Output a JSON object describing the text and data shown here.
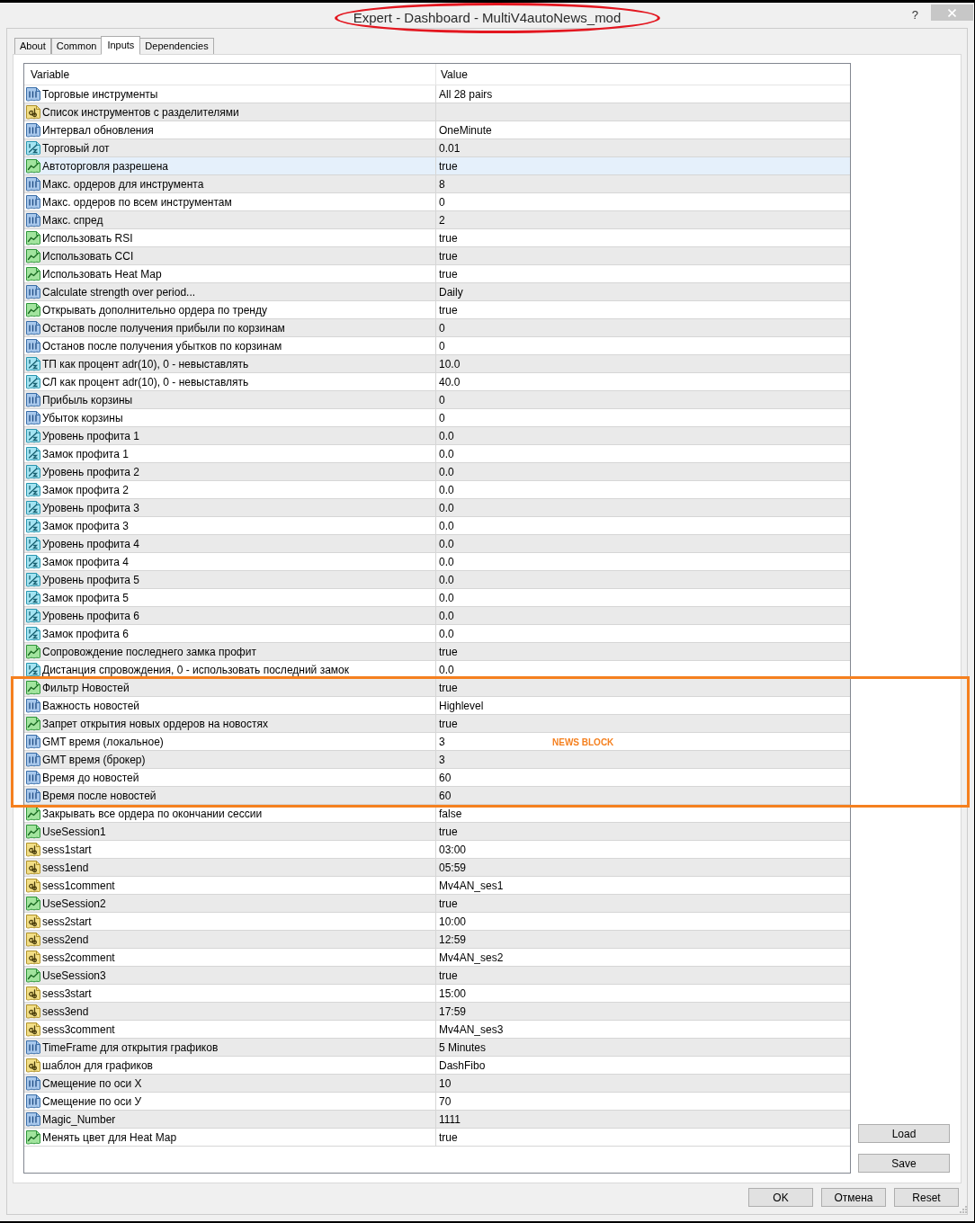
{
  "window": {
    "title": "Expert - Dashboard - MultiV4autoNews_mod",
    "title_circled": true,
    "help": "?"
  },
  "tabs": [
    {
      "label": "About",
      "selected": false
    },
    {
      "label": "Common",
      "selected": false
    },
    {
      "label": "Inputs",
      "selected": true
    },
    {
      "label": "Dependencies",
      "selected": false
    }
  ],
  "table": {
    "columns": [
      "Variable",
      "Value"
    ],
    "sections": [
      {
        "rows": [
          {
            "kind": "int",
            "variable": "Торговые инструменты",
            "value": "All 28 pairs",
            "selected": false
          },
          {
            "kind": "string",
            "variable": "Список инструментов с разделителями",
            "selected": false
          },
          {
            "kind": "int",
            "variable": "Интервал обновления",
            "value": "OneMinute",
            "selected": false
          },
          {
            "kind": "double",
            "variable": "Торговый лот",
            "value": "0.01",
            "selected": false
          },
          {
            "kind": "bool",
            "variable": "Автоторговля разрешена",
            "value": "true",
            "selected": true
          },
          {
            "kind": "int",
            "variable": "Макс. ордеров для инструмента",
            "value": "8",
            "selected": false
          },
          {
            "kind": "int",
            "variable": "Макс. ордеров по всем инструментам",
            "value": "0",
            "selected": false
          },
          {
            "kind": "int",
            "variable": "Макс. спред",
            "value": "2",
            "selected": false
          },
          {
            "kind": "bool",
            "variable": "Использовать RSI",
            "value": "true",
            "selected": false
          },
          {
            "kind": "bool",
            "variable": "Использовать CCI",
            "value": "true",
            "selected": false
          },
          {
            "kind": "bool",
            "variable": "Использовать Heat Map",
            "value": "true",
            "selected": false
          },
          {
            "kind": "int",
            "variable": "Calculate strength over period...",
            "value": "Daily",
            "selected": false
          },
          {
            "kind": "bool",
            "variable": "Открывать дополнительно ордера по тренду",
            "value": "true",
            "selected": false
          },
          {
            "kind": "int",
            "variable": "Останов после получения прибыли по корзинам",
            "value": "0",
            "selected": false
          },
          {
            "kind": "int",
            "variable": "Останов после получения убытков по корзинам",
            "value": "0",
            "selected": false
          },
          {
            "kind": "double",
            "variable": "ТП как процент adr(10), 0 - невыставлять",
            "value": "10.0",
            "selected": false
          },
          {
            "kind": "double",
            "variable": "СЛ как процент adr(10), 0 - невыставлять",
            "value": "40.0",
            "selected": false
          },
          {
            "kind": "int",
            "variable": "Прибыль корзины",
            "value": "0",
            "selected": false
          },
          {
            "kind": "int",
            "variable": "Убыток корзины",
            "value": "0",
            "selected": false
          },
          {
            "kind": "double",
            "variable": "Уровень профита 1",
            "value": "0.0",
            "selected": false
          },
          {
            "kind": "double",
            "variable": "Замок профита 1",
            "value": "0.0",
            "selected": false
          },
          {
            "kind": "double",
            "variable": "Уровень профита 2",
            "value": "0.0",
            "selected": false
          },
          {
            "kind": "double",
            "variable": "Замок профита 2",
            "value": "0.0",
            "selected": false
          },
          {
            "kind": "double",
            "variable": "Уровень профита 3",
            "value": "0.0",
            "selected": false
          },
          {
            "kind": "double",
            "variable": "Замок профита 3",
            "value": "0.0",
            "selected": false
          },
          {
            "kind": "double",
            "variable": "Уровень профита 4",
            "value": "0.0",
            "selected": false
          },
          {
            "kind": "double",
            "variable": "Замок профита 4",
            "value": "0.0",
            "selected": false
          },
          {
            "kind": "double",
            "variable": "Уровень профита 5",
            "value": "0.0",
            "selected": false
          },
          {
            "kind": "double",
            "variable": "Замок профита 5",
            "value": "0.0",
            "selected": false
          },
          {
            "kind": "double",
            "variable": "Уровень профита 6",
            "value": "0.0",
            "selected": false
          },
          {
            "kind": "double",
            "variable": "Замок профита 6",
            "value": "0.0",
            "selected": false
          },
          {
            "kind": "bool",
            "variable": "Сопровождение последнего замка профит",
            "value": "true",
            "selected": false
          },
          {
            "kind": "double",
            "variable": "Дистанция спровождения, 0 - использовать последний замок",
            "value": "0.0",
            "selected": false
          }
        ]
      },
      {
        "boxed": true,
        "box_label": "NEWS BLOCK",
        "rows": [
          {
            "kind": "bool",
            "variable": "Фильтр Новостей",
            "value": "true",
            "selected": false
          },
          {
            "kind": "int",
            "variable": "Важность новостей",
            "value": "Highlevel",
            "selected": false
          },
          {
            "kind": "bool",
            "variable": "Запрет открытия новых ордеров на новостях",
            "value": "true",
            "selected": false
          },
          {
            "kind": "int",
            "variable": "GMT время (локальное)",
            "value": "3",
            "selected": false
          },
          {
            "kind": "int",
            "variable": "GMT время (брокер)",
            "value": "3",
            "selected": false
          },
          {
            "kind": "int",
            "variable": "Время до новостей",
            "value": "60",
            "selected": false
          },
          {
            "kind": "int",
            "variable": "Время после новостей",
            "value": "60",
            "selected": false
          }
        ]
      },
      {
        "rows": [
          {
            "kind": "bool",
            "variable": "Закрывать все ордера по окончании сессии",
            "value": "false",
            "selected": false
          },
          {
            "kind": "bool",
            "variable": "UseSession1",
            "value": "true",
            "selected": false
          },
          {
            "kind": "string",
            "variable": "sess1start",
            "value": "03:00",
            "selected": false
          },
          {
            "kind": "string",
            "variable": "sess1end",
            "value": "05:59",
            "selected": false
          },
          {
            "kind": "string",
            "variable": "sess1comment",
            "value": "Mv4AN_ses1",
            "selected": false
          },
          {
            "kind": "bool",
            "variable": "UseSession2",
            "value": "true",
            "selected": false
          },
          {
            "kind": "string",
            "variable": "sess2start",
            "value": "10:00",
            "selected": false
          },
          {
            "kind": "string",
            "variable": "sess2end",
            "value": "12:59",
            "selected": false
          },
          {
            "kind": "string",
            "variable": "sess2comment",
            "value": "Mv4AN_ses2",
            "selected": false
          },
          {
            "kind": "bool",
            "variable": "UseSession3",
            "value": "true",
            "selected": false
          },
          {
            "kind": "string",
            "variable": "sess3start",
            "value": "15:00",
            "selected": false
          },
          {
            "kind": "string",
            "variable": "sess3end",
            "value": "17:59",
            "selected": false
          },
          {
            "kind": "string",
            "variable": "sess3comment",
            "value": "Mv4AN_ses3",
            "selected": false
          },
          {
            "kind": "int",
            "variable": "TimeFrame для открытия графиков",
            "value": "5 Minutes",
            "selected": false
          },
          {
            "kind": "string",
            "variable": "шаблон для графиков",
            "value": "DashFibo",
            "selected": false
          },
          {
            "kind": "int",
            "variable": "Смещение по оси X",
            "value": "10",
            "selected": false
          },
          {
            "kind": "int",
            "variable": "Смещение по оси У",
            "value": "70",
            "selected": false
          },
          {
            "kind": "int",
            "variable": "Magic_Number",
            "value": "1111",
            "selected": false
          },
          {
            "kind": "bool",
            "variable": "Менять цвет для Heat Map",
            "value": "true",
            "selected": false
          }
        ]
      }
    ]
  },
  "side_buttons": [
    "Load",
    "Save"
  ],
  "buttons": [
    "OK",
    "Отмена",
    "Reset"
  ]
}
